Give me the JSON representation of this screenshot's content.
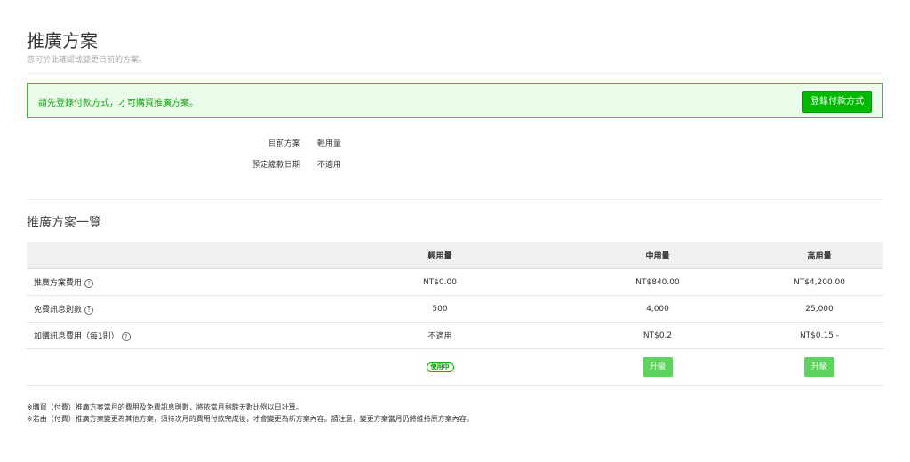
{
  "page": {
    "title": "推廣方案",
    "subtitle": "您可於此確認或變更目前的方案。"
  },
  "alert": {
    "message": "請先登錄付款方式，才可購買推廣方案。",
    "button_label": "登錄付款方式"
  },
  "current": {
    "plan_label": "目前方案",
    "plan_value": "輕用量",
    "next_payment_label": "預定繳款日期",
    "next_payment_value": "不適用"
  },
  "plans_section": {
    "title": "推廣方案一覽",
    "columns": [
      "",
      "輕用量",
      "中用量",
      "高用量"
    ],
    "rows": [
      {
        "label": "推廣方案費用",
        "values": [
          "NT$0.00",
          "NT$840.00",
          "NT$4,200.00"
        ]
      },
      {
        "label": "免費訊息則數",
        "values": [
          "500",
          "4,000",
          "25,000"
        ]
      },
      {
        "label": "加購訊息費用（每1則）",
        "values": [
          "不適用",
          "NT$0.2",
          "NT$0.15 -"
        ]
      }
    ],
    "in_use_badge": "使用中",
    "upgrade_label": "升級",
    "help_icon_glyph": "?"
  },
  "notes": [
    "※購買（付費）推廣方案當月的費用及免費訊息則數，將依當月剩餘天數比例以日計算。",
    "※若由（付費）推廣方案變更為其他方案，須待次月的費用付款完成後，才會變更為新方案內容。請注意，變更方案當月仍將維持原方案內容。"
  ]
}
